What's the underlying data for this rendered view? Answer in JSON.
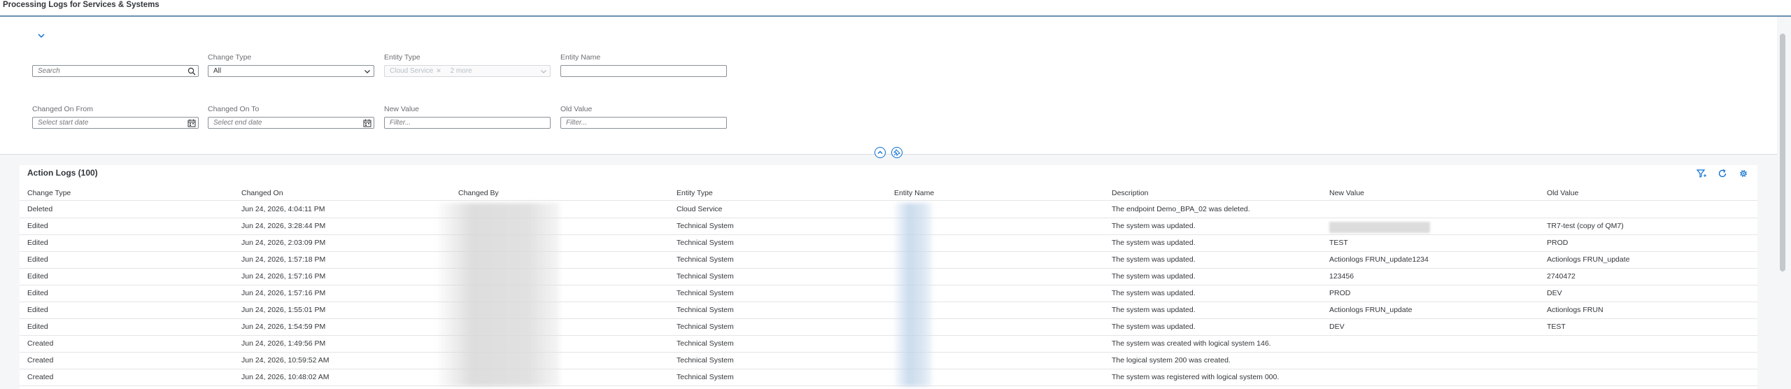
{
  "app": {
    "title": "Processing Logs for Services & Systems"
  },
  "filters": {
    "search": {
      "placeholder": "Search"
    },
    "change_type": {
      "label": "Change Type",
      "value": "All"
    },
    "entity_type": {
      "label": "Entity Type",
      "token": "Cloud Service",
      "more": "2 more"
    },
    "entity_name": {
      "label": "Entity Name",
      "value": ""
    },
    "changed_on_from": {
      "label": "Changed On From",
      "placeholder": "Select start date"
    },
    "changed_on_to": {
      "label": "Changed On To",
      "placeholder": "Select end date"
    },
    "new_value": {
      "label": "New Value",
      "placeholder": "Filter..."
    },
    "old_value": {
      "label": "Old Value",
      "placeholder": "Filter..."
    }
  },
  "table": {
    "title": "Action Logs (100)",
    "columns": [
      "Change Type",
      "Changed On",
      "Changed By",
      "Entity Type",
      "Entity Name",
      "Description",
      "New Value",
      "Old Value"
    ],
    "rows": [
      {
        "change_type": "Deleted",
        "changed_on": "Jun 24, 2026, 4:04:11 PM",
        "entity_type": "Cloud Service",
        "description": "The endpoint Demo_BPA_02 was deleted.",
        "new_value": "",
        "old_value": ""
      },
      {
        "change_type": "Edited",
        "changed_on": "Jun 24, 2026, 3:28:44 PM",
        "entity_type": "Technical System",
        "description": "The system was updated.",
        "new_value": "",
        "old_value": "TR7-test (copy of QM7)"
      },
      {
        "change_type": "Edited",
        "changed_on": "Jun 24, 2026, 2:03:09 PM",
        "entity_type": "Technical System",
        "description": "The system was updated.",
        "new_value": "TEST",
        "old_value": "PROD"
      },
      {
        "change_type": "Edited",
        "changed_on": "Jun 24, 2026, 1:57:18 PM",
        "entity_type": "Technical System",
        "description": "The system was updated.",
        "new_value": "Actionlogs FRUN_update1234",
        "old_value": "Actionlogs FRUN_update"
      },
      {
        "change_type": "Edited",
        "changed_on": "Jun 24, 2026, 1:57:16 PM",
        "entity_type": "Technical System",
        "description": "The system was updated.",
        "new_value": "123456",
        "old_value": "2740472"
      },
      {
        "change_type": "Edited",
        "changed_on": "Jun 24, 2026, 1:57:16 PM",
        "entity_type": "Technical System",
        "description": "The system was updated.",
        "new_value": "PROD",
        "old_value": "DEV"
      },
      {
        "change_type": "Edited",
        "changed_on": "Jun 24, 2026, 1:55:01 PM",
        "entity_type": "Technical System",
        "description": "The system was updated.",
        "new_value": "Actionlogs FRUN_update",
        "old_value": "Actionlogs FRUN"
      },
      {
        "change_type": "Edited",
        "changed_on": "Jun 24, 2026, 1:54:59 PM",
        "entity_type": "Technical System",
        "description": "The system was updated.",
        "new_value": "DEV",
        "old_value": "TEST"
      },
      {
        "change_type": "Created",
        "changed_on": "Jun 24, 2026, 1:49:56 PM",
        "entity_type": "Technical System",
        "description": "The system was created with logical system 146.",
        "new_value": "",
        "old_value": ""
      },
      {
        "change_type": "Created",
        "changed_on": "Jun 24, 2026, 10:59:52 AM",
        "entity_type": "Technical System",
        "description": "The logical system 200 was created.",
        "new_value": "",
        "old_value": ""
      },
      {
        "change_type": "Created",
        "changed_on": "Jun 24, 2026, 10:48:02 AM",
        "entity_type": "Technical System",
        "description": "The system was registered with logical system 000.",
        "new_value": "",
        "old_value": ""
      }
    ]
  },
  "colors": {
    "accent": "#0a6ed1",
    "title_underline": "#6a8fb0"
  },
  "icons": [
    "chevron-down-icon",
    "search-icon",
    "calendar-icon",
    "chevron-up-icon",
    "pin-icon",
    "filter-icon",
    "refresh-icon",
    "settings-icon"
  ]
}
